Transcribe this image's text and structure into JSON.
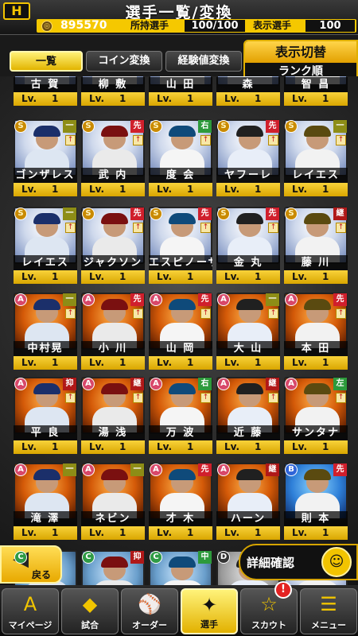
{
  "header": {
    "logo": "H",
    "title": "選手一覧/変換",
    "coin_icon": "coin-icon",
    "coins": "895570",
    "owned_label": "所持選手",
    "owned_value": "100/100",
    "shown_label": "表示選手",
    "shown_value": "100"
  },
  "tabs": [
    {
      "label": "一覧",
      "active": true
    },
    {
      "label": "コイン変換",
      "active": false
    },
    {
      "label": "経験値変換",
      "active": false
    }
  ],
  "display_switch": {
    "label": "表示切替",
    "value": "ランク順"
  },
  "cards": [
    {
      "name": "古 賀",
      "level": "1"
    },
    {
      "name": "柳 敷",
      "level": "1"
    },
    {
      "name": "山 田",
      "level": "1"
    },
    {
      "name": "森",
      "level": "1"
    },
    {
      "name": "智 昌",
      "level": "1"
    },
    {
      "name": "ゴンザレス",
      "level": "1",
      "rank": "S",
      "pos": "一",
      "arrow": "↑"
    },
    {
      "name": "武 内",
      "level": "1",
      "rank": "S",
      "pos": "先",
      "arrow": "↑"
    },
    {
      "name": "度 会",
      "level": "1",
      "rank": "S",
      "pos": "右",
      "arrow": "↑"
    },
    {
      "name": "ヤフーレ",
      "level": "1",
      "rank": "S",
      "pos": "先",
      "arrow": "↑"
    },
    {
      "name": "レイエス",
      "level": "1",
      "rank": "S",
      "pos": "一",
      "arrow": "↑"
    },
    {
      "name": "レイエス",
      "level": "1",
      "rank": "S",
      "pos": "一",
      "arrow": "↑"
    },
    {
      "name": "ジャクソン",
      "level": "1",
      "rank": "S",
      "pos": "先",
      "arrow": "↑"
    },
    {
      "name": "エスピノーザ",
      "level": "1",
      "rank": "S",
      "pos": "先",
      "arrow": "↑"
    },
    {
      "name": "金 丸",
      "level": "1",
      "rank": "S",
      "pos": "先",
      "arrow": "↑"
    },
    {
      "name": "藤 川",
      "level": "1",
      "rank": "S",
      "pos": "継",
      "arrow": "↑"
    },
    {
      "name": "中村晃",
      "level": "1",
      "rank": "A",
      "pos": "一",
      "arrow": "↑"
    },
    {
      "name": "小 川",
      "level": "1",
      "rank": "A",
      "pos": "先",
      "arrow": "↑"
    },
    {
      "name": "山 岡",
      "level": "1",
      "rank": "A",
      "pos": "先",
      "arrow": "↑"
    },
    {
      "name": "大 山",
      "level": "1",
      "rank": "A",
      "pos": "一",
      "arrow": "↑"
    },
    {
      "name": "本 田",
      "level": "1",
      "rank": "A",
      "pos": "先",
      "arrow": "↑"
    },
    {
      "name": "平 良",
      "level": "1",
      "rank": "A",
      "pos": "抑",
      "arrow": "↑"
    },
    {
      "name": "湯 浅",
      "level": "1",
      "rank": "A",
      "pos": "継",
      "arrow": "↑"
    },
    {
      "name": "万 波",
      "level": "1",
      "rank": "A",
      "pos": "右",
      "arrow": "↑"
    },
    {
      "name": "近 藤",
      "level": "1",
      "rank": "A",
      "pos": "継",
      "arrow": "↑"
    },
    {
      "name": "サンタナ",
      "level": "1",
      "rank": "A",
      "pos": "左",
      "arrow": "↑"
    },
    {
      "name": "滝 澤",
      "level": "1",
      "rank": "A",
      "pos": "一",
      "arrow": ""
    },
    {
      "name": "ネビン",
      "level": "1",
      "rank": "A",
      "pos": "一",
      "arrow": ""
    },
    {
      "name": "才 木",
      "level": "1",
      "rank": "A",
      "pos": "先",
      "arrow": ""
    },
    {
      "name": "ハーン",
      "level": "1",
      "rank": "A",
      "pos": "継",
      "arrow": ""
    },
    {
      "name": "則 本",
      "level": "1",
      "rank": "B",
      "pos": "先",
      "arrow": ""
    },
    {
      "name": "",
      "level": "",
      "rank": "C",
      "pos": "",
      "arrow": ""
    },
    {
      "name": "",
      "level": "",
      "rank": "C",
      "pos": "抑",
      "arrow": ""
    },
    {
      "name": "",
      "level": "",
      "rank": "C",
      "pos": "中",
      "arrow": ""
    },
    {
      "name": "",
      "level": "",
      "rank": "D",
      "pos": "",
      "arrow": ""
    },
    {
      "name": "",
      "level": "",
      "rank": "",
      "pos": "",
      "arrow": ""
    }
  ],
  "level_prefix": "Lv.",
  "back_button": {
    "label": "戻る",
    "icon": "back-arrow-icon"
  },
  "detail_button": {
    "label": "詳細確認",
    "icon": "person-icon"
  },
  "nav": [
    {
      "label": "マイページ",
      "icon": "home-icon",
      "active": false
    },
    {
      "label": "試合",
      "icon": "baseball-field-icon",
      "active": false
    },
    {
      "label": "オーダー",
      "icon": "lineup-icon",
      "active": false
    },
    {
      "label": "選手",
      "icon": "player-icon",
      "active": true
    },
    {
      "label": "スカウト",
      "icon": "scout-icon",
      "active": false
    },
    {
      "label": "メニュー",
      "icon": "menu-icon",
      "active": false
    }
  ],
  "scout_badge": "!"
}
